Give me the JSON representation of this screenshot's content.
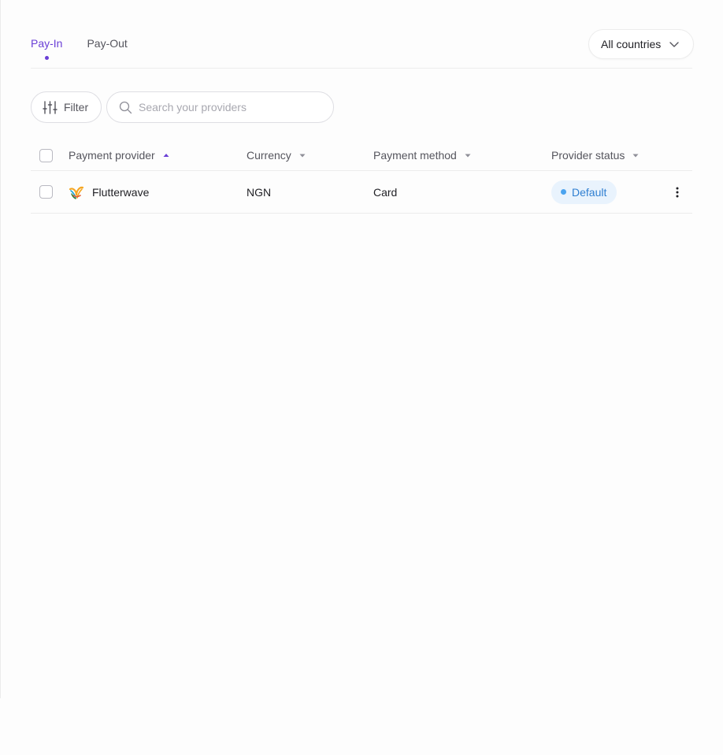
{
  "tabs": [
    {
      "label": "Pay-In",
      "active": true
    },
    {
      "label": "Pay-Out",
      "active": false
    }
  ],
  "country_selector": {
    "label": "All countries",
    "icon": "chevron-down-icon"
  },
  "toolbar": {
    "filter_label": "Filter",
    "filter_icon": "sliders-icon",
    "search_placeholder": "Search your providers",
    "search_value": "",
    "search_icon": "search-icon"
  },
  "table": {
    "columns": [
      {
        "label": "Payment provider",
        "sort": "asc"
      },
      {
        "label": "Currency",
        "sort": "none"
      },
      {
        "label": "Payment method",
        "sort": "none"
      },
      {
        "label": "Provider status",
        "sort": "none"
      }
    ],
    "rows": [
      {
        "provider": "Flutterwave",
        "provider_icon": "flutterwave-logo",
        "currency": "NGN",
        "method": "Card",
        "status": "Default",
        "actions_icon": "kebab-menu-icon"
      }
    ]
  },
  "colors": {
    "accent": "#6a3fd6",
    "status_badge_bg": "#e9f3fd",
    "status_badge_text": "#2f7fd1",
    "status_dot": "#4aa3ef",
    "border": "#ececec"
  }
}
